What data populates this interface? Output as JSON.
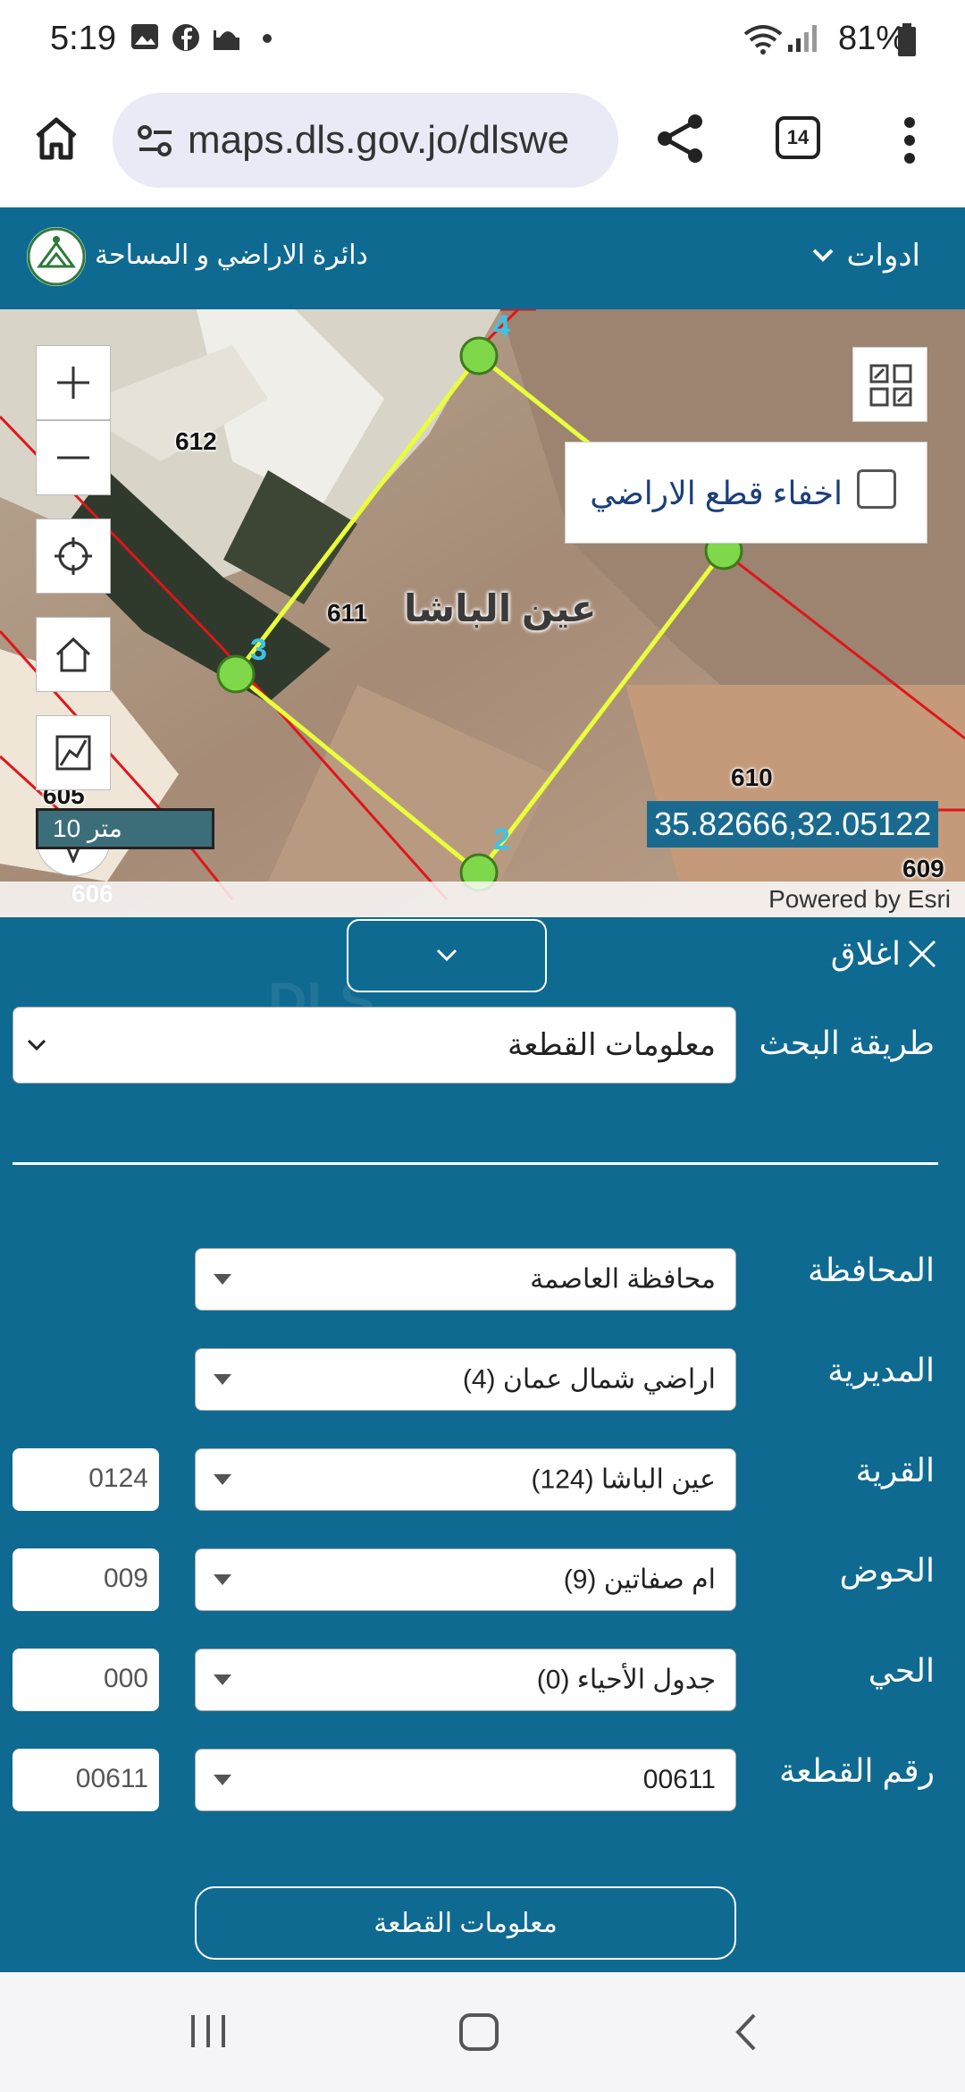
{
  "status_bar": {
    "time": "5:19",
    "battery": "81%",
    "icons": [
      "gallery-icon",
      "facebook-icon",
      "mosque-icon",
      "dot-icon",
      "wifi-icon",
      "signal-icon",
      "battery-icon"
    ]
  },
  "browser": {
    "url": "maps.dls.gov.jo/dlswe",
    "tabs_count": "14"
  },
  "header": {
    "title": "دائرة الاراضي و المساحة",
    "tools_label": "ادوات"
  },
  "map": {
    "hide_parcels_label": "اخفاء قطع الاراضي",
    "hide_parcels_checked": false,
    "place_name": "عين الباشا",
    "scale_label": "10 متر",
    "coordinates": "35.82666,32.05122",
    "powered_by": "Powered by Esri",
    "parcel_labels": [
      "612",
      "611",
      "610",
      "609",
      "606",
      "605"
    ],
    "vertex_labels": [
      "4",
      "3",
      "2"
    ],
    "colors": {
      "parcel_line": "#e8ff3a",
      "vertex": "#7ed84a",
      "boundary": "#e0151b"
    }
  },
  "panel": {
    "close_label": "اغلاق",
    "search_method_label": "طريقة البحث",
    "search_method_value": "معلومات القطعة",
    "fields": [
      {
        "label": "المحافظة",
        "value": "محافظة العاصمة",
        "code": ""
      },
      {
        "label": "المديرية",
        "value": "اراضي شمال عمان (4)",
        "code": ""
      },
      {
        "label": "القرية",
        "value": "عين الباشا (124)",
        "code": "0124"
      },
      {
        "label": "الحوض",
        "value": "ام صفاتين (9)",
        "code": "009"
      },
      {
        "label": "الحي",
        "value": "جدول الأحياء (0)",
        "code": "000"
      },
      {
        "label": "رقم القطعة",
        "value": "00611",
        "code": "00611"
      }
    ],
    "submit_label": "معلومات القطعة",
    "accent": "#0f6a91"
  }
}
